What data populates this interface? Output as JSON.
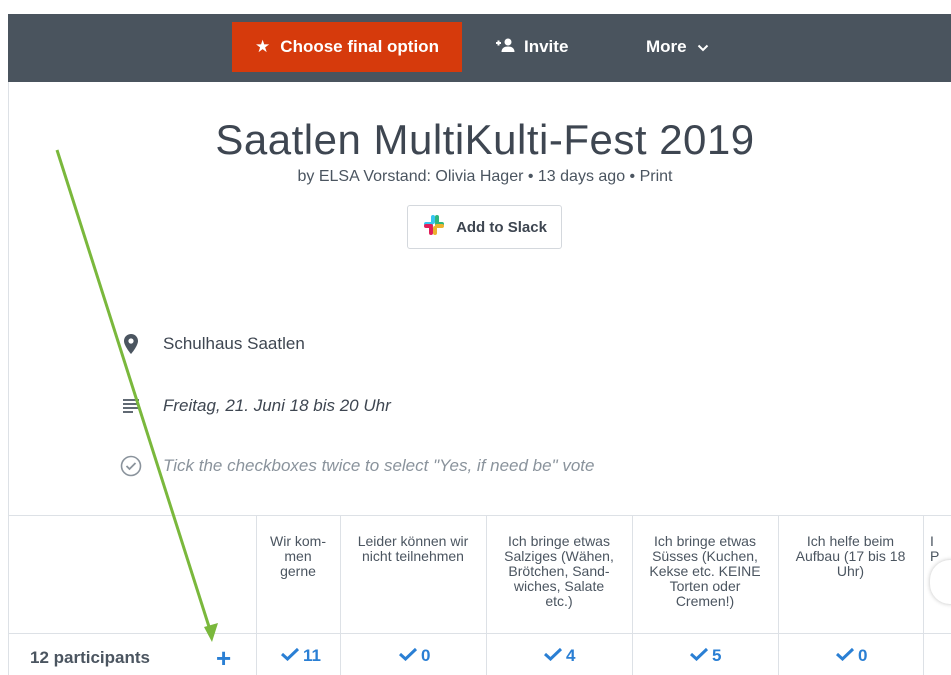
{
  "toolbar": {
    "choose_final_label": "Choose final option",
    "invite_label": "Invite",
    "more_label": "More"
  },
  "poll": {
    "title": "Saatlen MultiKulti-Fest 2019",
    "byline": "by ELSA Vorstand: Olivia Hager • 13 days ago • Print",
    "slack_label": "Add to Slack",
    "location": "Schulhaus Saatlen",
    "description": "Freitag, 21. Juni 18 bis 20 Uhr",
    "hint": "Tick the checkboxes twice to select \"Yes, if need be\" vote"
  },
  "table": {
    "participants_label": "12 participants",
    "options": [
      {
        "label": "Wir kom-\nmen\ngerne",
        "count": "11"
      },
      {
        "label": "Leider können wir\nnicht teilnehmen",
        "count": "0"
      },
      {
        "label": "Ich bringe etwas\nSalziges (Wähen,\nBrötchen, Sand-\nwiches, Salate\netc.)",
        "count": "4"
      },
      {
        "label": "Ich bringe etwas\nSüsses (Kuchen,\nKekse etc. KEINE\nTorten oder\nCremen!)",
        "count": "5"
      },
      {
        "label": "Ich helfe beim\nAufbau (17 bis 18\nUhr)",
        "count": "0"
      },
      {
        "label": "I\nP",
        "count": ""
      }
    ]
  },
  "colors": {
    "toolbar_bg": "#4a545e",
    "accent": "#d63a0c",
    "check_blue": "#2a7fd4",
    "annotation_green": "#7ab83c"
  },
  "icons": [
    "star-icon",
    "add-person-icon",
    "chevron-down-icon",
    "slack-icon",
    "location-pin-icon",
    "description-icon",
    "check-circle-icon",
    "plus-icon",
    "checkmark-icon"
  ]
}
